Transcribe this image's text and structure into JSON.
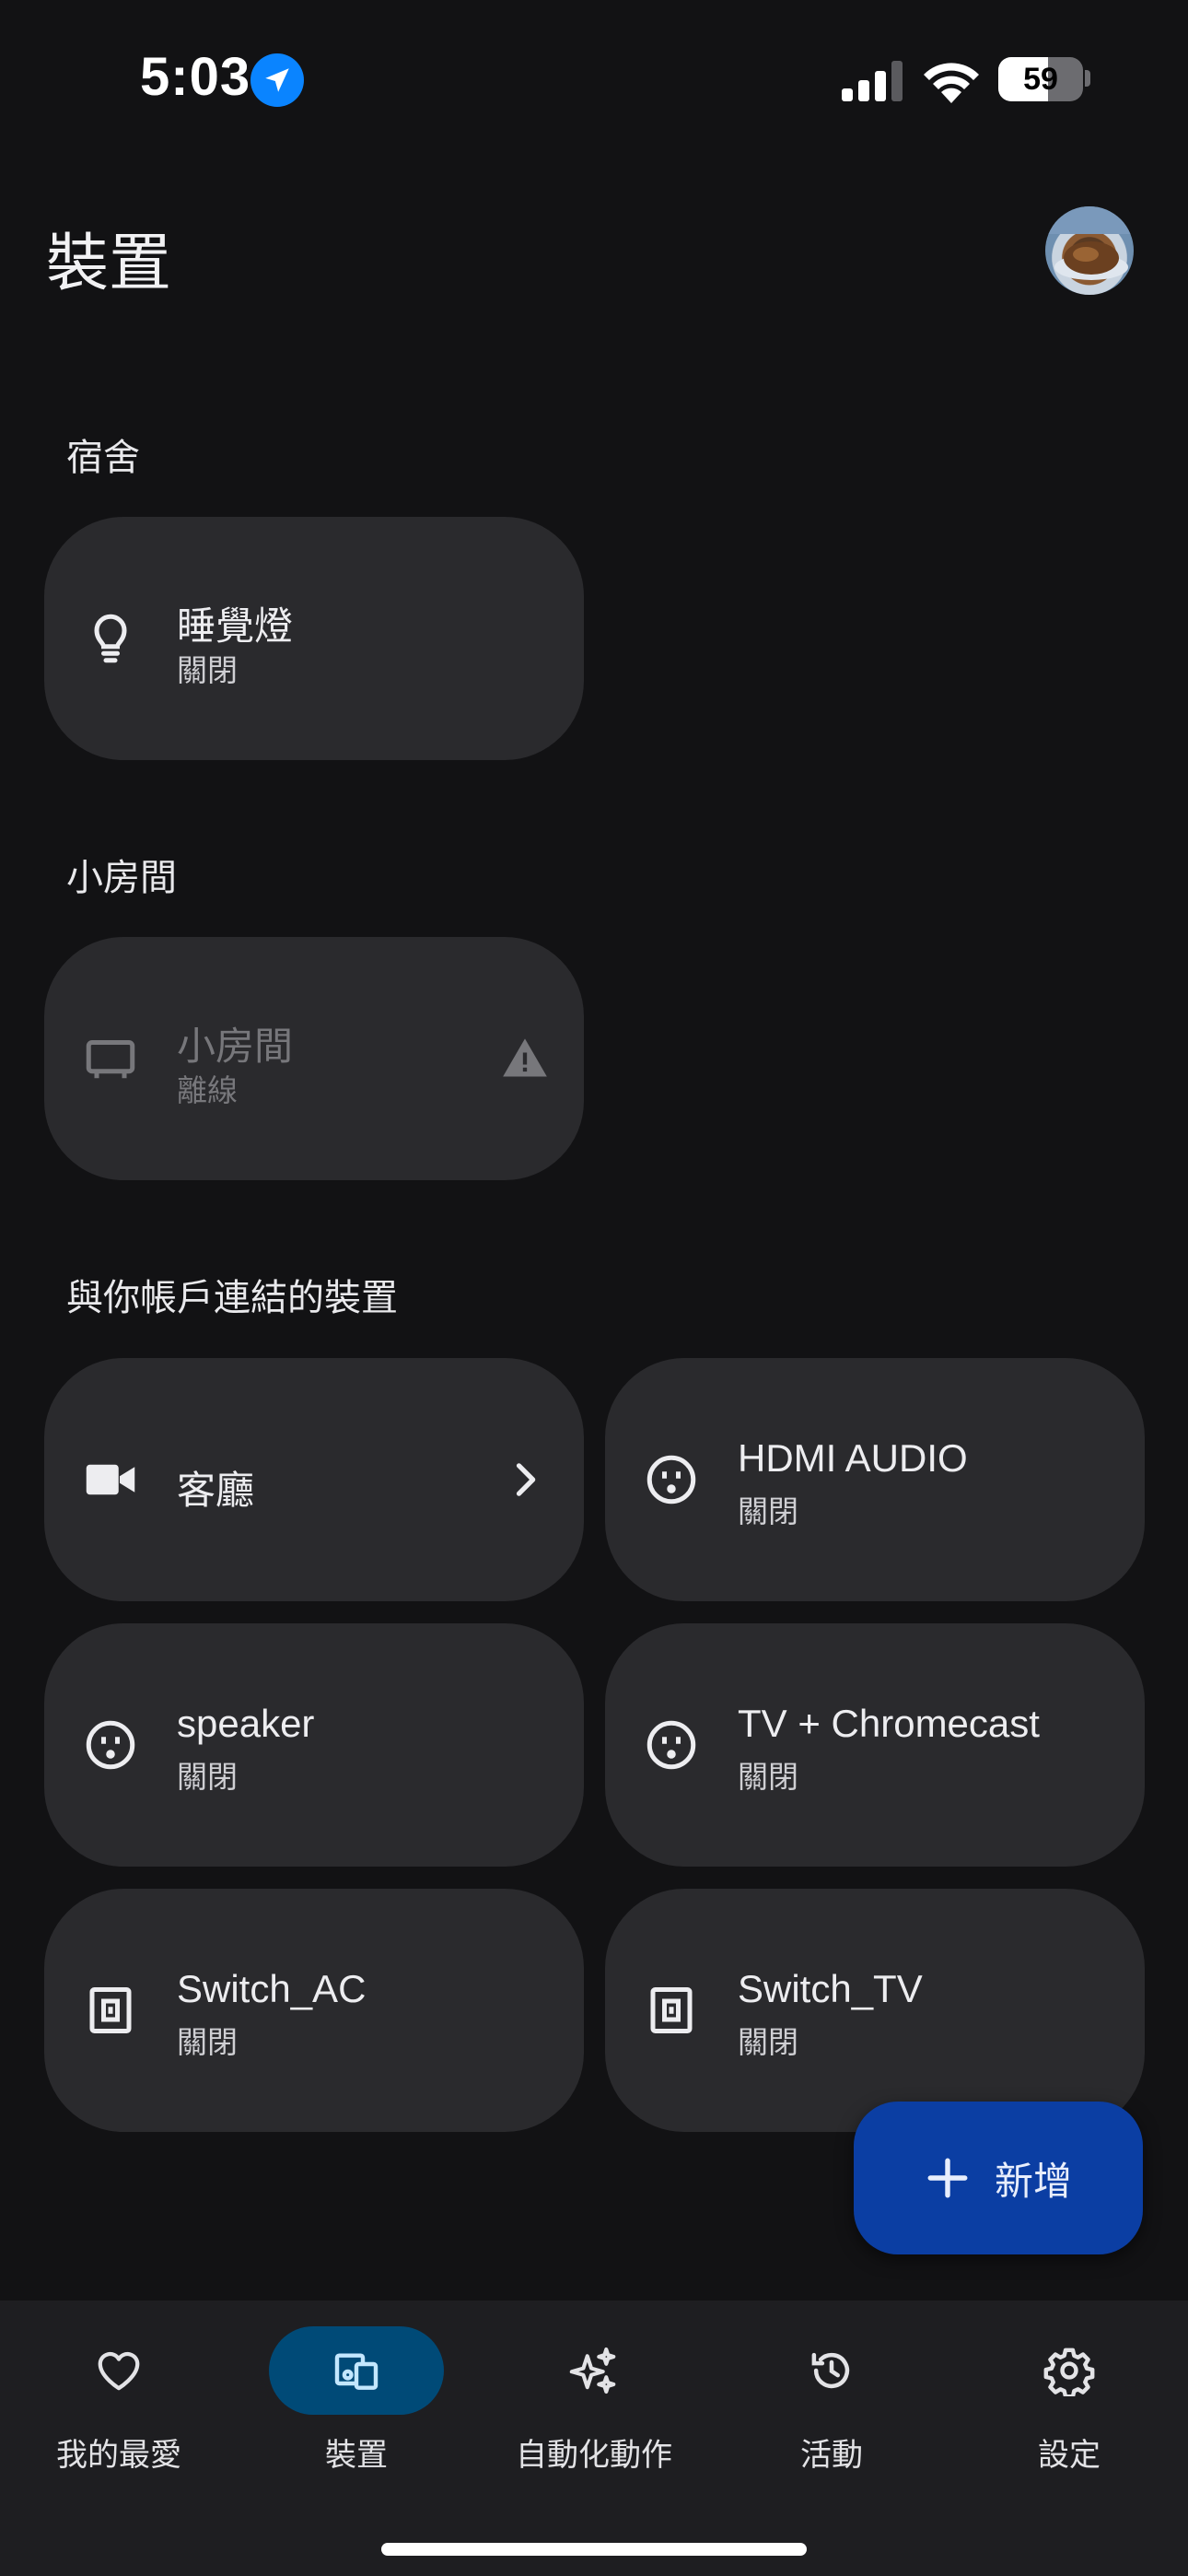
{
  "status_bar": {
    "time": "5:03",
    "battery": "59",
    "battery_level": 0.59
  },
  "header": {
    "title": "裝置"
  },
  "sections": [
    {
      "title": "宿舍"
    },
    {
      "title": "小房間"
    },
    {
      "title": "與你帳戶連結的裝置"
    }
  ],
  "devices": {
    "sleep_lamp": {
      "name": "睡覺燈",
      "status": "關閉",
      "icon": "lightbulb-icon"
    },
    "small_room": {
      "name": "小房間",
      "status": "離線",
      "icon": "tv-icon"
    },
    "living_room": {
      "name": "客廳",
      "icon": "camera-icon"
    },
    "hdmi_audio": {
      "name": "HDMI AUDIO",
      "status": "關閉",
      "icon": "outlet-icon"
    },
    "speaker": {
      "name": "speaker",
      "status": "關閉",
      "icon": "outlet-icon"
    },
    "tv_chromecast": {
      "name": "TV + Chromecast",
      "status": "關閉",
      "icon": "outlet-icon"
    },
    "switch_ac": {
      "name": "Switch_AC",
      "status": "關閉",
      "icon": "switch-icon"
    },
    "switch_tv": {
      "name": "Switch_TV",
      "status": "關閉",
      "icon": "switch-icon"
    }
  },
  "fab": {
    "label": "新增"
  },
  "nav": [
    {
      "label": "我的最愛",
      "icon": "heart-icon"
    },
    {
      "label": "裝置",
      "icon": "devices-icon",
      "active": true
    },
    {
      "label": "自動化動作",
      "icon": "sparkle-icon"
    },
    {
      "label": "活動",
      "icon": "history-icon"
    },
    {
      "label": "設定",
      "icon": "gear-icon"
    }
  ],
  "colors": {
    "background": "#121214",
    "tile": "#2a2a2d",
    "fab": "#0b3ea3",
    "nav_active": "#004a77",
    "location_badge": "#0a84ff"
  }
}
